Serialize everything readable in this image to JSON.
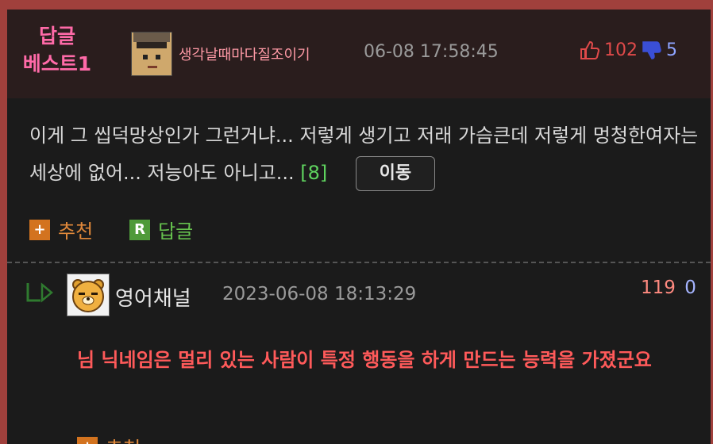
{
  "best_comment": {
    "badge_line1": "답글",
    "badge_line2": "베스트1",
    "nickname": "생각날때마다질조이기",
    "timestamp": "06-08 17:58:45",
    "likes": "102",
    "dislikes": "5",
    "body": "이게 그 씹덕망상인가 그런거냐... 저렇게 생기고 저래 가슴큰데 저렇게 멍청한여자는 세상에 없어... 저능아도 아니고...",
    "reply_count": "[8]",
    "move_label": "이동",
    "recommend_label": "추천",
    "reply_label": "답글"
  },
  "reply": {
    "nickname": "영어채널",
    "timestamp": "2023-06-08 18:13:29",
    "likes": "119",
    "dislikes": "0",
    "body": "님 닉네임은 멀리 있는 사람이 특정 행동을 하게 만드는 능력을 가졌군요",
    "recommend_label": "추천"
  },
  "icons": {
    "like": "thumbs-up-icon",
    "dislike": "thumbs-down-icon",
    "reply_arrow": "reply-arrow-icon"
  },
  "colors": {
    "border": "#a0403c",
    "badge": "#ff6aa8",
    "like": "#e04a4a",
    "dislike": "#8ea4ff",
    "reply_text": "#ff5a5a",
    "recommend": "#d3731f",
    "reply_btn": "#4f9a3a"
  }
}
